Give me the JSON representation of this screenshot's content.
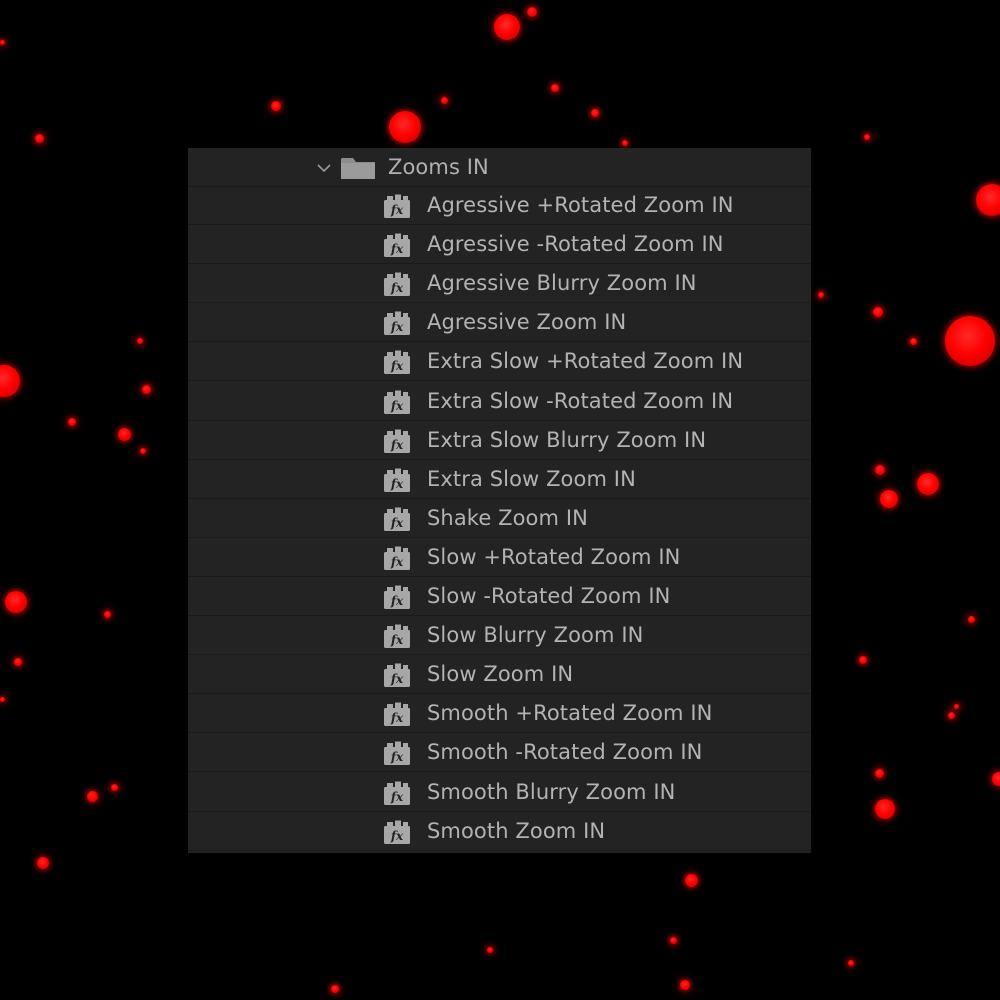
{
  "folder": {
    "name": "Zooms IN",
    "expanded": true,
    "chevron_icon": "chevron-down-icon",
    "folder_icon": "folder-icon"
  },
  "items_icon": "effect-preset-fx-icon",
  "items": [
    {
      "label": "Agressive +Rotated Zoom IN"
    },
    {
      "label": "Agressive -Rotated Zoom IN"
    },
    {
      "label": "Agressive Blurry Zoom IN"
    },
    {
      "label": "Agressive Zoom IN"
    },
    {
      "label": "Extra Slow +Rotated Zoom IN"
    },
    {
      "label": "Extra Slow -Rotated Zoom IN"
    },
    {
      "label": "Extra Slow Blurry Zoom IN"
    },
    {
      "label": "Extra Slow Zoom IN"
    },
    {
      "label": "Shake Zoom IN"
    },
    {
      "label": "Slow +Rotated Zoom IN"
    },
    {
      "label": "Slow -Rotated Zoom IN"
    },
    {
      "label": "Slow Blurry Zoom IN"
    },
    {
      "label": "Slow Zoom IN"
    },
    {
      "label": "Smooth +Rotated Zoom IN"
    },
    {
      "label": "Smooth -Rotated Zoom IN"
    },
    {
      "label": "Smooth Blurry Zoom IN"
    },
    {
      "label": "Smooth Zoom IN"
    }
  ],
  "colors": {
    "background": "#000000",
    "panel": "#232323",
    "text": "#b3b3b3",
    "particle": "#ff0000"
  }
}
